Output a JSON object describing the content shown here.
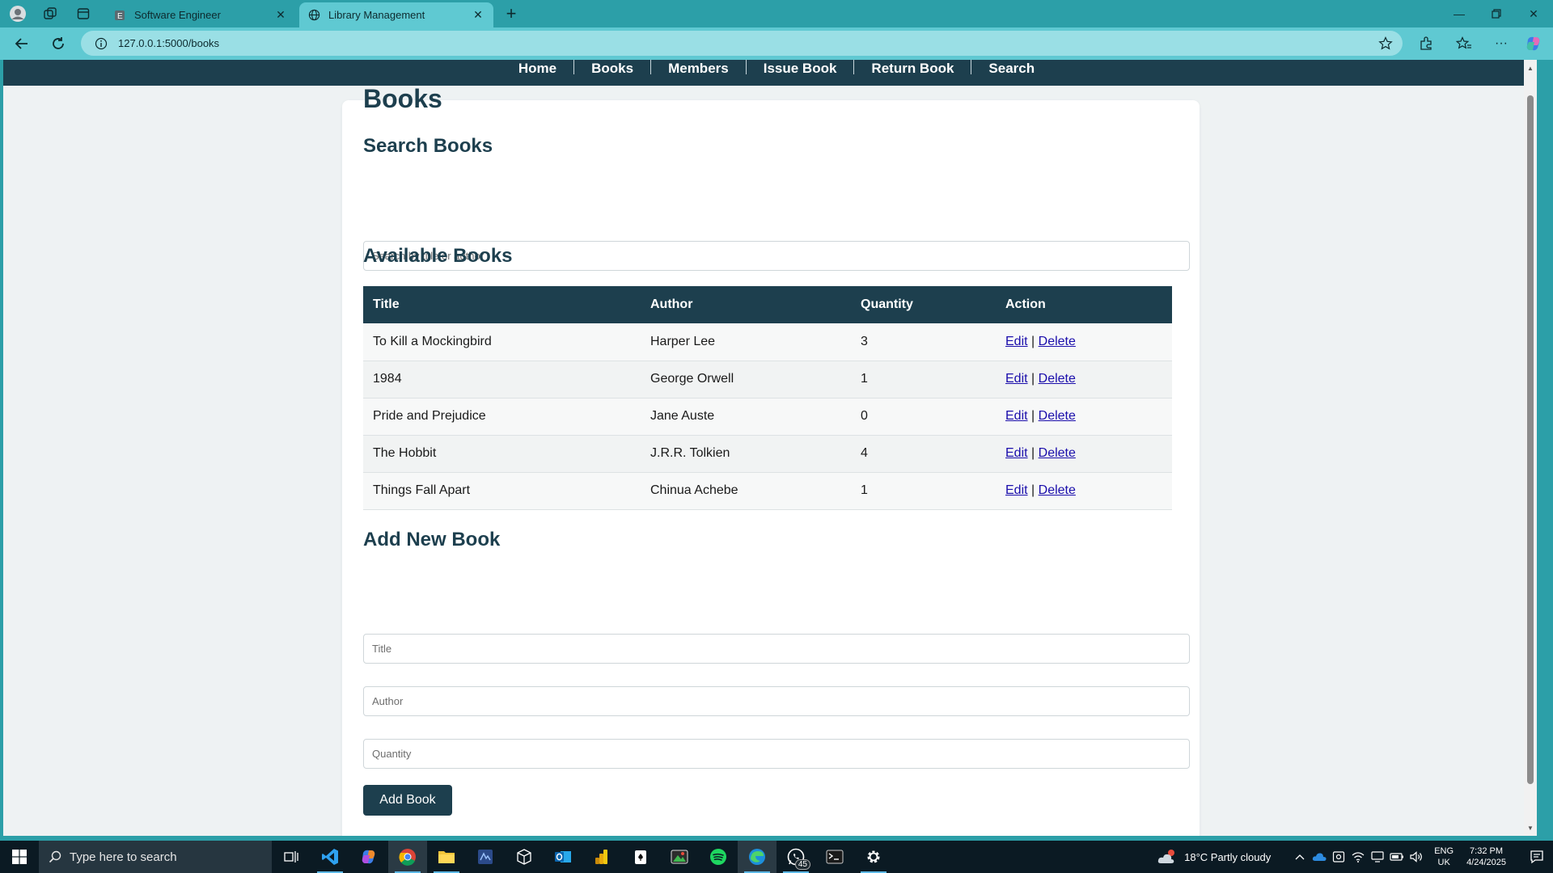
{
  "browser": {
    "tabs": [
      {
        "label": "Software Engineer",
        "active": false
      },
      {
        "label": "Library Management",
        "active": true
      }
    ],
    "url": "127.0.0.1:5000/books"
  },
  "nav": {
    "links": [
      "Home",
      "Books",
      "Members",
      "Issue Book",
      "Return Book",
      "Search"
    ]
  },
  "page": {
    "title": "Books",
    "search_heading": "Search Books",
    "search_placeholder": "Search by title or author",
    "available_heading": "Available Books",
    "add_heading": "Add New Book",
    "add_title_placeholder": "Title",
    "add_author_placeholder": "Author",
    "add_quantity_placeholder": "Quantity",
    "add_button": "Add Book"
  },
  "table": {
    "columns": [
      "Title",
      "Author",
      "Quantity",
      "Action"
    ],
    "rows": [
      {
        "title": "To Kill a Mockingbird",
        "author": "Harper Lee",
        "quantity": "3"
      },
      {
        "title": "1984",
        "author": "George Orwell",
        "quantity": "1"
      },
      {
        "title": "Pride and Prejudice",
        "author": "Jane Auste",
        "quantity": "0"
      },
      {
        "title": "The Hobbit",
        "author": "J.R.R. Tolkien",
        "quantity": "4"
      },
      {
        "title": "Things Fall Apart",
        "author": "Chinua Achebe",
        "quantity": "1"
      }
    ],
    "edit_label": "Edit",
    "separator": "|",
    "delete_label": "Delete"
  },
  "taskbar": {
    "search_placeholder": "Type here to search",
    "whatsapp_badge": "45",
    "weather": "18°C  Partly cloudy",
    "lang_top": "ENG",
    "lang_bottom": "UK",
    "time": "7:32 PM",
    "date": "4/24/2025"
  },
  "colors": {
    "chrome": "#2c9fa8",
    "navbar": "#1d3f4e",
    "heading": "#1d3f4e",
    "link": "#1a0dab"
  }
}
